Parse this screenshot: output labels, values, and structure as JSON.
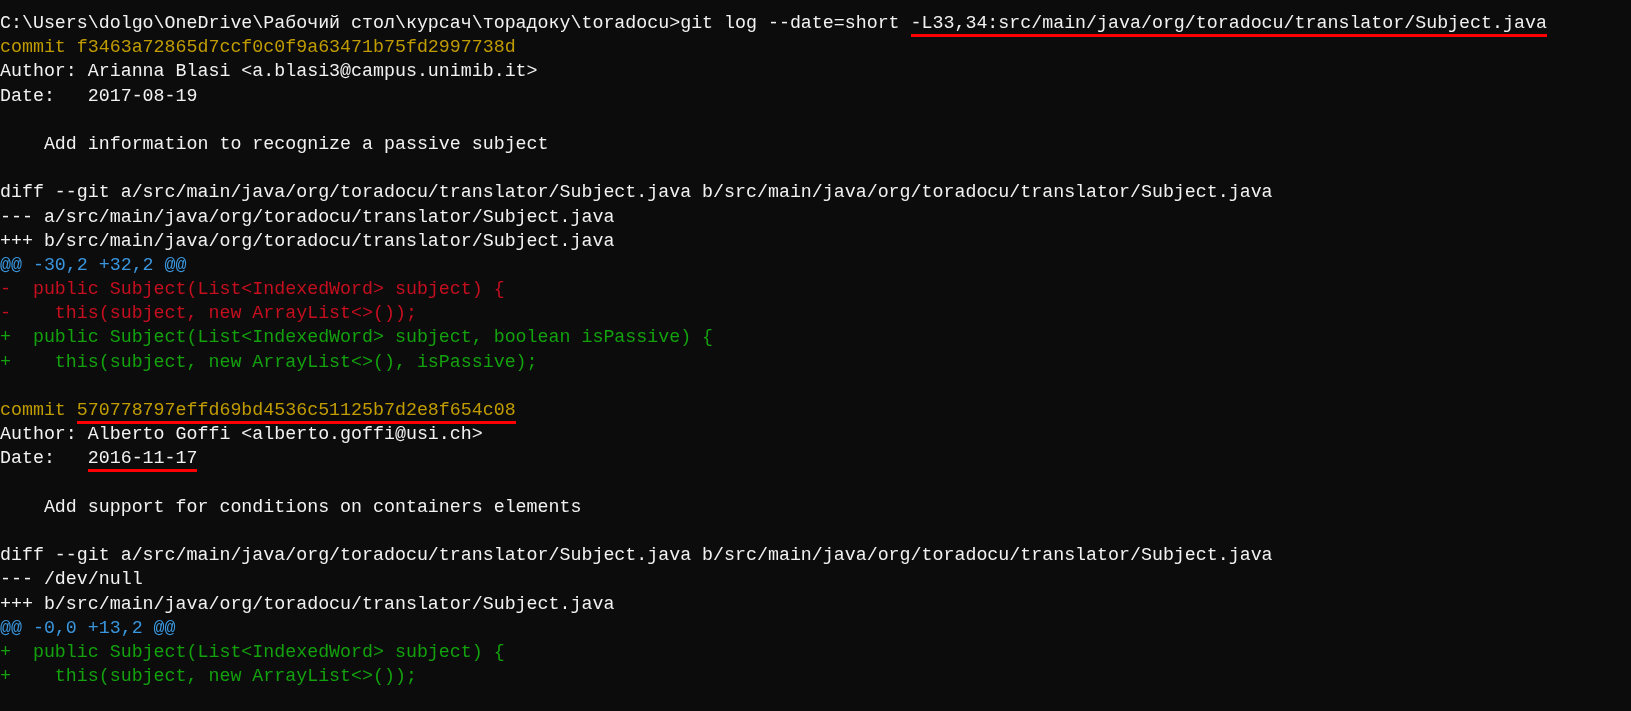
{
  "terminal": {
    "lines": [
      {
        "kind": "plain",
        "segments": [
          {
            "text": "C:\\Users\\dolgo\\OneDrive\\Рабочий стол\\курсач\\торадоку\\toradocu>git log --date=short ",
            "underlined": false
          },
          {
            "text": "-L33,34:src/main/java/org/toradocu/translator/Subject.java",
            "underlined": true
          }
        ]
      },
      {
        "kind": "commit",
        "segments": [
          {
            "text": "commit f3463a72865d7ccf0c0f9a63471b75fd2997738d",
            "underlined": false
          }
        ]
      },
      {
        "kind": "plain",
        "segments": [
          {
            "text": "Author: Arianna Blasi <a.blasi3@campus.unimib.it>",
            "underlined": false
          }
        ]
      },
      {
        "kind": "plain",
        "segments": [
          {
            "text": "Date:   2017-08-19",
            "underlined": false
          }
        ]
      },
      {
        "kind": "blank"
      },
      {
        "kind": "plain",
        "segments": [
          {
            "text": "    Add information to recognize a passive subject",
            "underlined": false
          }
        ]
      },
      {
        "kind": "blank"
      },
      {
        "kind": "plain",
        "segments": [
          {
            "text": "diff --git a/src/main/java/org/toradocu/translator/Subject.java b/src/main/java/org/toradocu/translator/Subject.java",
            "underlined": false
          }
        ]
      },
      {
        "kind": "plain",
        "segments": [
          {
            "text": "--- a/src/main/java/org/toradocu/translator/Subject.java",
            "underlined": false
          }
        ]
      },
      {
        "kind": "plain",
        "segments": [
          {
            "text": "+++ b/src/main/java/org/toradocu/translator/Subject.java",
            "underlined": false
          }
        ]
      },
      {
        "kind": "hunk",
        "segments": [
          {
            "text": "@@ -30,2 +32,2 @@",
            "underlined": false
          }
        ]
      },
      {
        "kind": "removed",
        "segments": [
          {
            "text": "-  public Subject(List<IndexedWord> subject) {",
            "underlined": false
          }
        ]
      },
      {
        "kind": "removed",
        "segments": [
          {
            "text": "-    this(subject, new ArrayList<>());",
            "underlined": false
          }
        ]
      },
      {
        "kind": "added",
        "segments": [
          {
            "text": "+  public Subject(List<IndexedWord> subject, boolean isPassive) {",
            "underlined": false
          }
        ]
      },
      {
        "kind": "added",
        "segments": [
          {
            "text": "+    this(subject, new ArrayList<>(), isPassive);",
            "underlined": false
          }
        ]
      },
      {
        "kind": "blank"
      },
      {
        "kind": "commit",
        "segments": [
          {
            "text": "commit ",
            "underlined": false
          },
          {
            "text": "570778797effd69bd4536c51125b7d2e8f654c08",
            "underlined": true
          }
        ]
      },
      {
        "kind": "plain",
        "segments": [
          {
            "text": "Author: Alberto Goffi <alberto.goffi@usi.ch>",
            "underlined": false
          }
        ]
      },
      {
        "kind": "plain",
        "segments": [
          {
            "text": "Date:   ",
            "underlined": false
          },
          {
            "text": "2016-11-17",
            "underlined": true
          }
        ]
      },
      {
        "kind": "blank"
      },
      {
        "kind": "plain",
        "segments": [
          {
            "text": "    Add support for conditions on containers elements",
            "underlined": false
          }
        ]
      },
      {
        "kind": "blank"
      },
      {
        "kind": "plain",
        "segments": [
          {
            "text": "diff --git a/src/main/java/org/toradocu/translator/Subject.java b/src/main/java/org/toradocu/translator/Subject.java",
            "underlined": false
          }
        ]
      },
      {
        "kind": "plain",
        "segments": [
          {
            "text": "--- /dev/null",
            "underlined": false
          }
        ]
      },
      {
        "kind": "plain",
        "segments": [
          {
            "text": "+++ b/src/main/java/org/toradocu/translator/Subject.java",
            "underlined": false
          }
        ]
      },
      {
        "kind": "hunk",
        "segments": [
          {
            "text": "@@ -0,0 +13,2 @@",
            "underlined": false
          }
        ]
      },
      {
        "kind": "added",
        "segments": [
          {
            "text": "+  public Subject(List<IndexedWord> subject) {",
            "underlined": false
          }
        ]
      },
      {
        "kind": "added",
        "segments": [
          {
            "text": "+    this(subject, new ArrayList<>());",
            "underlined": false
          }
        ]
      }
    ]
  }
}
